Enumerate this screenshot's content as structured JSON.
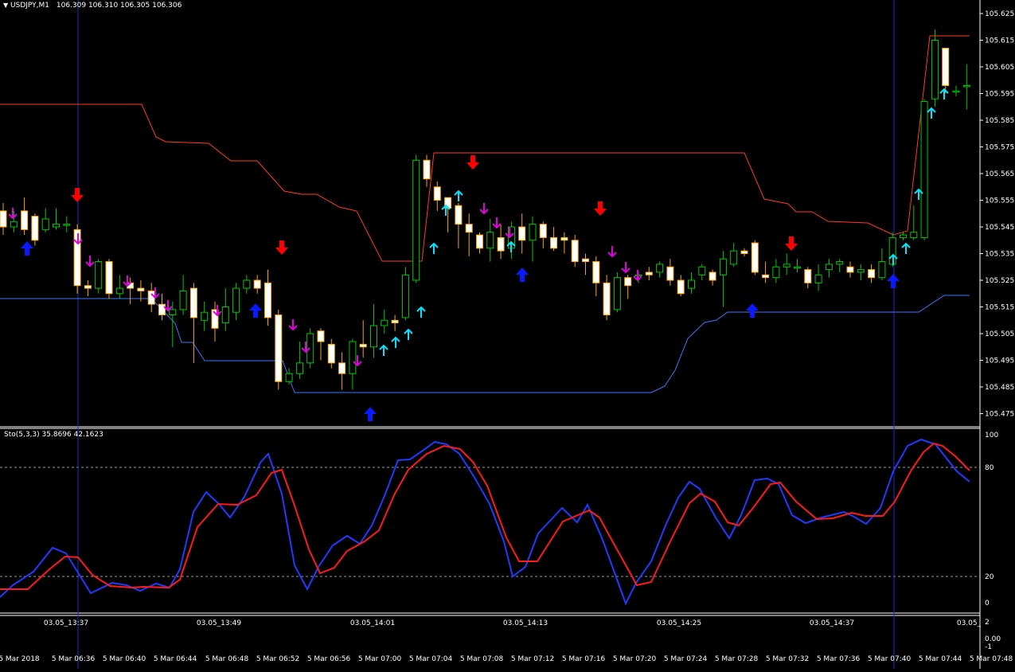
{
  "chart_header": {
    "symbol_label": "USDJPY,M1",
    "quote_values": "106.309 106.310 106.305 106.306"
  },
  "stochastic_header": {
    "label": "Sto(5,3,3) 35.8696 42.1623"
  },
  "colors": {
    "background": "#000000",
    "bull_candle_outline": "#00c800",
    "bear_candle_body": "#ffffff",
    "wick_bear": "#ffa500",
    "upper_channel": "#ff3b1f",
    "lower_channel": "#3a78ff",
    "stoch_main": "#1e3bff",
    "stoch_signal": "#ff1a1a",
    "big_down_arrow": "#ff0000",
    "big_up_arrow": "#0a1aff",
    "small_down_arrow": "#e000e0",
    "small_up_arrow": "#00e5ff",
    "separator": "#ffffff",
    "vertical_marker": "#1e2bd0"
  },
  "price_axis": {
    "ticks": [
      "105.625",
      "105.615",
      "105.605",
      "105.595",
      "105.585",
      "105.575",
      "105.565",
      "105.555",
      "105.545",
      "105.535",
      "105.525",
      "105.515",
      "105.505",
      "105.495",
      "105.485",
      "105.475"
    ]
  },
  "stoch_axis": {
    "ticks": [
      "100",
      "80",
      "20",
      "0"
    ]
  },
  "bottom_axis": {
    "ticks": [
      "2",
      "0.00",
      "-1"
    ]
  },
  "time_axis_top": [
    "03.05_13:37",
    "03.05_13:49",
    "03.05_14:01",
    "03.05_14:13",
    "03.05_14:25",
    "03.05_14:37",
    "03.05_"
  ],
  "time_axis_bottom": [
    "5 Mar 2018",
    "5 Mar 06:36",
    "5 Mar 06:40",
    "5 Mar 06:44",
    "5 Mar 06:48",
    "5 Mar 06:52",
    "5 Mar 06:56",
    "5 Mar 07:00",
    "5 Mar 07:04",
    "5 Mar 07:08",
    "5 Mar 07:12",
    "5 Mar 07:16",
    "5 Mar 07:20",
    "5 Mar 07:24",
    "5 Mar 07:28",
    "5 Mar 07:32",
    "5 Mar 07:36",
    "5 Mar 07:40",
    "5 Mar 07:44",
    "5 Mar 07:48"
  ],
  "candles": [
    [
      105.551,
      105.545,
      105.554,
      105.542
    ],
    [
      105.545,
      105.547,
      105.551,
      105.543
    ],
    [
      105.551,
      105.544,
      105.556,
      105.542
    ],
    [
      105.549,
      105.54,
      105.55,
      105.538
    ],
    [
      105.544,
      105.548,
      105.552,
      105.543
    ],
    [
      105.545,
      105.546,
      105.552,
      105.544
    ],
    [
      105.546,
      105.546,
      105.549,
      105.543
    ],
    [
      105.544,
      105.523,
      105.546,
      105.52
    ],
    [
      105.523,
      105.522,
      105.525,
      105.519
    ],
    [
      105.522,
      105.532,
      105.533,
      105.52
    ],
    [
      105.532,
      105.52,
      105.533,
      105.518
    ],
    [
      105.52,
      105.522,
      105.527,
      105.518
    ],
    [
      105.524,
      105.522,
      105.526,
      105.516
    ],
    [
      105.522,
      105.521,
      105.525,
      105.517
    ],
    [
      105.521,
      105.516,
      105.524,
      105.513
    ],
    [
      105.516,
      105.512,
      105.52,
      105.51
    ],
    [
      105.512,
      105.514,
      105.517,
      105.5
    ],
    [
      105.514,
      105.521,
      105.527,
      105.512
    ],
    [
      105.522,
      105.511,
      105.524,
      105.494
    ],
    [
      105.51,
      105.513,
      105.517,
      105.506
    ],
    [
      105.514,
      105.507,
      105.517,
      105.502
    ],
    [
      105.509,
      105.515,
      105.522,
      105.506
    ],
    [
      105.513,
      105.522,
      105.524,
      105.51
    ],
    [
      105.522,
      105.525,
      105.527,
      105.52
    ],
    [
      105.525,
      105.522,
      105.527,
      105.52
    ],
    [
      105.524,
      105.511,
      105.529,
      105.508
    ],
    [
      105.512,
      105.487,
      105.514,
      105.484
    ],
    [
      105.487,
      105.49,
      105.492,
      105.486
    ],
    [
      105.49,
      105.494,
      105.502,
      105.488
    ],
    [
      105.494,
      105.505,
      105.507,
      105.492
    ],
    [
      105.506,
      105.502,
      105.507,
      105.495
    ],
    [
      105.501,
      105.494,
      105.503,
      105.492
    ],
    [
      105.494,
      105.49,
      105.498,
      105.484
    ],
    [
      105.49,
      105.502,
      105.503,
      105.484
    ],
    [
      105.501,
      105.5,
      105.51,
      105.496
    ],
    [
      105.5,
      105.508,
      105.516,
      105.496
    ],
    [
      105.508,
      105.51,
      105.514,
      105.505
    ],
    [
      105.51,
      105.509,
      105.512,
      105.506
    ],
    [
      105.511,
      105.527,
      105.53,
      105.51
    ],
    [
      105.525,
      105.57,
      105.572,
      105.524
    ],
    [
      105.57,
      105.563,
      105.572,
      105.56
    ],
    [
      105.56,
      105.555,
      105.562,
      105.551
    ],
    [
      105.556,
      105.552,
      105.556,
      105.543
    ],
    [
      105.553,
      105.546,
      105.554,
      105.537
    ],
    [
      105.546,
      105.543,
      105.55,
      105.534
    ],
    [
      105.542,
      105.537,
      105.543,
      105.535
    ],
    [
      105.537,
      105.543,
      105.548,
      105.532
    ],
    [
      105.541,
      105.536,
      105.546,
      105.533
    ],
    [
      105.537,
      105.545,
      105.547,
      105.533
    ],
    [
      105.545,
      105.54,
      105.55,
      105.535
    ],
    [
      105.54,
      105.546,
      105.549,
      105.532
    ],
    [
      105.546,
      105.541,
      105.547,
      105.537
    ],
    [
      105.541,
      105.537,
      105.545,
      105.536
    ],
    [
      105.541,
      105.54,
      105.543,
      105.535
    ],
    [
      105.54,
      105.532,
      105.542,
      105.53
    ],
    [
      105.533,
      105.532,
      105.535,
      105.527
    ],
    [
      105.532,
      105.524,
      105.534,
      105.519
    ],
    [
      105.524,
      105.512,
      105.527,
      105.51
    ],
    [
      105.514,
      105.526,
      105.528,
      105.513
    ],
    [
      105.526,
      105.523,
      105.527,
      105.518
    ],
    [
      105.527,
      105.527,
      105.528,
      105.524
    ],
    [
      105.528,
      105.527,
      105.53,
      105.525
    ],
    [
      105.528,
      105.531,
      105.532,
      105.526
    ],
    [
      105.53,
      105.525,
      105.533,
      105.523
    ],
    [
      105.525,
      105.52,
      105.527,
      105.519
    ],
    [
      105.522,
      105.525,
      105.528,
      105.52
    ],
    [
      105.527,
      105.53,
      105.531,
      105.525
    ],
    [
      105.528,
      105.525,
      105.529,
      105.523
    ],
    [
      105.527,
      105.533,
      105.536,
      105.515
    ],
    [
      105.531,
      105.536,
      105.539,
      105.53
    ],
    [
      105.536,
      105.535,
      105.537,
      105.534
    ],
    [
      105.539,
      105.528,
      105.54,
      105.527
    ],
    [
      105.527,
      105.526,
      105.532,
      105.524
    ],
    [
      105.526,
      105.53,
      105.533,
      105.524
    ],
    [
      105.53,
      105.531,
      105.535,
      105.527
    ],
    [
      105.53,
      105.53,
      105.533,
      105.528
    ],
    [
      105.529,
      105.524,
      105.53,
      105.522
    ],
    [
      105.524,
      105.527,
      105.531,
      105.521
    ],
    [
      105.529,
      105.531,
      105.533,
      105.526
    ],
    [
      105.531,
      105.532,
      105.533,
      105.528
    ],
    [
      105.53,
      105.528,
      105.532,
      105.526
    ],
    [
      105.528,
      105.529,
      105.531,
      105.525
    ],
    [
      105.529,
      105.526,
      105.531,
      105.524
    ],
    [
      105.526,
      105.532,
      105.537,
      105.525
    ],
    [
      105.531,
      105.541,
      105.543,
      105.53
    ],
    [
      105.541,
      105.542,
      105.543,
      105.54
    ],
    [
      105.541,
      105.543,
      105.553,
      105.54
    ],
    [
      105.541,
      105.592,
      105.593,
      105.54
    ],
    [
      105.593,
      105.615,
      105.619,
      105.59
    ],
    [
      105.612,
      105.598,
      105.61,
      105.595
    ],
    [
      105.596,
      105.596,
      105.598,
      105.594
    ],
    [
      105.598,
      105.598,
      105.606,
      105.589
    ]
  ],
  "upper_channel_path": [
    [
      0,
      131
    ],
    [
      178,
      131
    ],
    [
      196,
      172
    ],
    [
      208,
      178
    ],
    [
      262,
      180
    ],
    [
      290,
      202
    ],
    [
      323,
      202
    ],
    [
      357,
      240
    ],
    [
      379,
      244
    ],
    [
      398,
      244
    ],
    [
      426,
      260
    ],
    [
      448,
      265
    ],
    [
      480,
      328
    ],
    [
      530,
      328
    ],
    [
      545,
      192
    ],
    [
      935,
      192
    ],
    [
      960,
      250
    ],
    [
      990,
      256
    ],
    [
      1000,
      266
    ],
    [
      1020,
      266
    ],
    [
      1040,
      278
    ],
    [
      1090,
      280
    ],
    [
      1122,
      295
    ],
    [
      1140,
      290
    ],
    [
      1168,
      45
    ],
    [
      1218,
      45
    ]
  ],
  "lower_channel_path": [
    [
      0,
      375
    ],
    [
      190,
      375
    ],
    [
      220,
      406
    ],
    [
      228,
      430
    ],
    [
      242,
      430
    ],
    [
      257,
      453
    ],
    [
      355,
      453
    ],
    [
      370,
      493
    ],
    [
      818,
      493
    ],
    [
      835,
      485
    ],
    [
      848,
      465
    ],
    [
      864,
      425
    ],
    [
      885,
      405
    ],
    [
      900,
      402
    ],
    [
      914,
      392
    ],
    [
      1154,
      392
    ],
    [
      1186,
      371
    ],
    [
      1218,
      371
    ]
  ],
  "stoch_main": [
    [
      0,
      750
    ],
    [
      16,
      735
    ],
    [
      42,
      718
    ],
    [
      66,
      688
    ],
    [
      83,
      695
    ],
    [
      114,
      745
    ],
    [
      141,
      732
    ],
    [
      159,
      735
    ],
    [
      176,
      742
    ],
    [
      196,
      733
    ],
    [
      213,
      738
    ],
    [
      226,
      715
    ],
    [
      243,
      643
    ],
    [
      259,
      618
    ],
    [
      276,
      634
    ],
    [
      289,
      650
    ],
    [
      307,
      624
    ],
    [
      327,
      581
    ],
    [
      337,
      570
    ],
    [
      354,
      620
    ],
    [
      370,
      710
    ],
    [
      386,
      740
    ],
    [
      400,
      712
    ],
    [
      418,
      685
    ],
    [
      436,
      673
    ],
    [
      452,
      683
    ],
    [
      467,
      660
    ],
    [
      483,
      623
    ],
    [
      500,
      578
    ],
    [
      515,
      577
    ],
    [
      531,
      566
    ],
    [
      546,
      555
    ],
    [
      561,
      558
    ],
    [
      577,
      570
    ],
    [
      595,
      598
    ],
    [
      615,
      633
    ],
    [
      633,
      680
    ],
    [
      644,
      724
    ],
    [
      660,
      712
    ],
    [
      676,
      670
    ],
    [
      706,
      638
    ],
    [
      725,
      656
    ],
    [
      738,
      634
    ],
    [
      757,
      678
    ],
    [
      773,
      722
    ],
    [
      786,
      758
    ],
    [
      799,
      732
    ],
    [
      818,
      705
    ],
    [
      836,
      660
    ],
    [
      852,
      625
    ],
    [
      866,
      605
    ],
    [
      879,
      614
    ],
    [
      899,
      650
    ],
    [
      916,
      676
    ],
    [
      931,
      647
    ],
    [
      948,
      603
    ],
    [
      964,
      601
    ],
    [
      978,
      608
    ],
    [
      995,
      647
    ],
    [
      1012,
      657
    ],
    [
      1032,
      650
    ],
    [
      1060,
      643
    ],
    [
      1071,
      648
    ],
    [
      1088,
      658
    ],
    [
      1106,
      638
    ],
    [
      1122,
      592
    ],
    [
      1140,
      560
    ],
    [
      1157,
      552
    ],
    [
      1175,
      558
    ],
    [
      1202,
      592
    ],
    [
      1218,
      605
    ]
  ],
  "stoch_signal": [
    [
      0,
      740
    ],
    [
      35,
      740
    ],
    [
      62,
      715
    ],
    [
      82,
      699
    ],
    [
      98,
      700
    ],
    [
      116,
      722
    ],
    [
      138,
      736
    ],
    [
      166,
      738
    ],
    [
      180,
      737
    ],
    [
      212,
      738
    ],
    [
      226,
      728
    ],
    [
      248,
      662
    ],
    [
      274,
      633
    ],
    [
      298,
      634
    ],
    [
      322,
      622
    ],
    [
      341,
      594
    ],
    [
      354,
      590
    ],
    [
      370,
      635
    ],
    [
      388,
      690
    ],
    [
      402,
      720
    ],
    [
      420,
      713
    ],
    [
      436,
      692
    ],
    [
      458,
      680
    ],
    [
      476,
      666
    ],
    [
      496,
      620
    ],
    [
      513,
      590
    ],
    [
      536,
      570
    ],
    [
      558,
      560
    ],
    [
      578,
      564
    ],
    [
      594,
      580
    ],
    [
      612,
      610
    ],
    [
      636,
      675
    ],
    [
      652,
      705
    ],
    [
      675,
      705
    ],
    [
      707,
      655
    ],
    [
      740,
      641
    ],
    [
      753,
      650
    ],
    [
      775,
      690
    ],
    [
      800,
      735
    ],
    [
      818,
      731
    ],
    [
      842,
      680
    ],
    [
      866,
      632
    ],
    [
      880,
      620
    ],
    [
      898,
      630
    ],
    [
      914,
      656
    ],
    [
      928,
      660
    ],
    [
      946,
      638
    ],
    [
      968,
      608
    ],
    [
      980,
      606
    ],
    [
      1000,
      630
    ],
    [
      1026,
      652
    ],
    [
      1046,
      651
    ],
    [
      1070,
      644
    ],
    [
      1087,
      648
    ],
    [
      1109,
      648
    ],
    [
      1124,
      630
    ],
    [
      1145,
      590
    ],
    [
      1160,
      568
    ],
    [
      1173,
      557
    ],
    [
      1184,
      560
    ],
    [
      1200,
      573
    ],
    [
      1218,
      591
    ]
  ],
  "arrows": [
    [
      "s_dn",
      16,
      268
    ],
    [
      "b_up",
      34,
      312
    ],
    [
      "b_dn",
      97,
      245
    ],
    [
      "s_dn",
      98,
      300
    ],
    [
      "s_dn",
      113,
      328
    ],
    [
      "s_dn",
      160,
      353
    ],
    [
      "s_dn",
      195,
      368
    ],
    [
      "s_dn",
      211,
      384
    ],
    [
      "s_dn",
      273,
      390
    ],
    [
      "b_up",
      321,
      390
    ],
    [
      "b_dn",
      354,
      311
    ],
    [
      "s_dn",
      368,
      408
    ],
    [
      "s_dn",
      384,
      436
    ],
    [
      "s_dn",
      449,
      453
    ],
    [
      "b_up",
      465,
      520
    ],
    [
      "s_up",
      482,
      440
    ],
    [
      "s_up",
      497,
      430
    ],
    [
      "s_up",
      513,
      420
    ],
    [
      "s_up",
      529,
      392
    ],
    [
      "s_up",
      545,
      312
    ],
    [
      "s_up",
      560,
      264
    ],
    [
      "s_up",
      576,
      246
    ],
    [
      "b_dn",
      594,
      204
    ],
    [
      "s_dn",
      608,
      262
    ],
    [
      "s_dn",
      624,
      280
    ],
    [
      "s_dn",
      640,
      292
    ],
    [
      "s_up",
      642,
      310
    ],
    [
      "b_up",
      656,
      345
    ],
    [
      "b_dn",
      754,
      262
    ],
    [
      "s_dn",
      769,
      316
    ],
    [
      "s_dn",
      786,
      336
    ],
    [
      "s_dn",
      801,
      346
    ],
    [
      "b_up",
      945,
      390
    ],
    [
      "b_dn",
      994,
      306
    ],
    [
      "b_up",
      1122,
      353
    ],
    [
      "s_up",
      1122,
      326
    ],
    [
      "s_up",
      1138,
      312
    ],
    [
      "s_up",
      1154,
      244
    ],
    [
      "s_up",
      1170,
      142
    ],
    [
      "s_up",
      1186,
      118
    ]
  ]
}
